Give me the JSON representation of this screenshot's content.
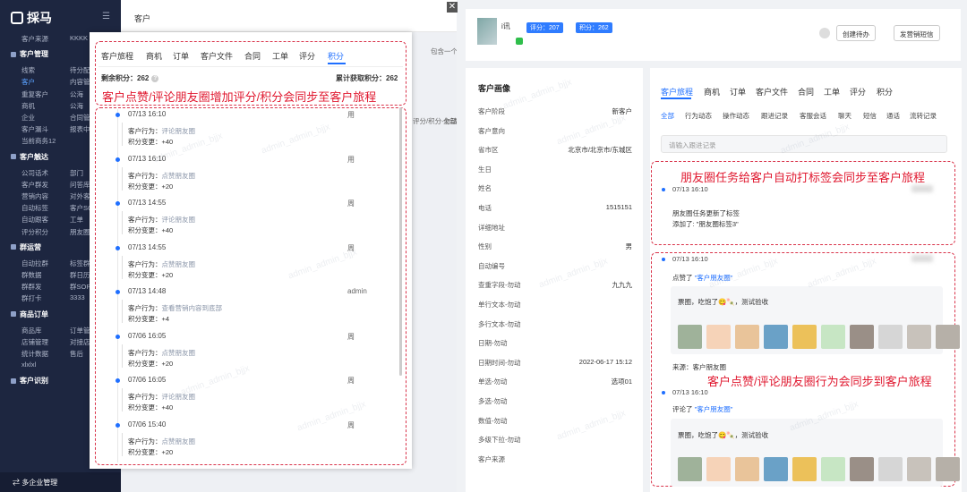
{
  "sidebar": {
    "logo": "採马",
    "items": [
      {
        "kind": "row",
        "a": "客户来源",
        "b": "KKKK"
      },
      {
        "kind": "group",
        "label": "客户管理"
      },
      {
        "kind": "row",
        "a": "线索",
        "b": "待分配"
      },
      {
        "kind": "row",
        "a": "客户",
        "b": "内容管",
        "active": true
      },
      {
        "kind": "row",
        "a": "重复客户",
        "b": "公海"
      },
      {
        "kind": "row",
        "a": "商机",
        "b": "公海"
      },
      {
        "kind": "row",
        "a": "企业",
        "b": "合同管"
      },
      {
        "kind": "row",
        "a": "客户漏斗",
        "b": "报表中"
      },
      {
        "kind": "row",
        "a": "当前商务12",
        "b": ""
      },
      {
        "kind": "group",
        "label": "客户触达"
      },
      {
        "kind": "row",
        "a": "公司话术",
        "b": "部门"
      },
      {
        "kind": "row",
        "a": "客户群发",
        "b": "问答库"
      },
      {
        "kind": "row",
        "a": "营销内容",
        "b": "对外客"
      },
      {
        "kind": "row",
        "a": "自动标签",
        "b": "客户SO"
      },
      {
        "kind": "row",
        "a": "自动跟客",
        "b": "工单"
      },
      {
        "kind": "row",
        "a": "评分积分",
        "b": "朋友圈"
      },
      {
        "kind": "group",
        "label": "群运营"
      },
      {
        "kind": "row",
        "a": "自动拉群",
        "b": "标签群"
      },
      {
        "kind": "row",
        "a": "群数据",
        "b": "群日历"
      },
      {
        "kind": "row",
        "a": "群群发",
        "b": "群SOP"
      },
      {
        "kind": "row",
        "a": "群打卡",
        "b": "3333"
      },
      {
        "kind": "group",
        "label": "商品订单"
      },
      {
        "kind": "row",
        "a": "商品库",
        "b": "订单管"
      },
      {
        "kind": "row",
        "a": "店铺管理",
        "b": "对接店"
      },
      {
        "kind": "row",
        "a": "统计数据",
        "b": "售后"
      },
      {
        "kind": "row",
        "a": "xlxlxl",
        "b": ""
      },
      {
        "kind": "group",
        "label": "客户识别"
      }
    ],
    "bottom": "多企业管理"
  },
  "left_page": {
    "title": "客户",
    "bg_texts": [
      "包含一个",
      "全部",
      "评分/积分-勿动"
    ]
  },
  "popup": {
    "tabs": [
      "客户旅程",
      "商机",
      "订单",
      "客户文件",
      "合同",
      "工单",
      "评分",
      "积分"
    ],
    "active_tab": 7,
    "remaining_label": "剩余积分：262",
    "total_label": "累计获取积分：262",
    "annotation": "客户点赞/评论朋友圈增加评分/积分会同步至客户旅程",
    "action_label": "客户行为：",
    "change_label": "积分变更：",
    "entries": [
      {
        "time": "07/13 16:10",
        "who": "用",
        "action": "评论朋友圈",
        "change": "+40"
      },
      {
        "time": "07/13 16:10",
        "who": "用",
        "action": "点赞朋友圈",
        "change": "+20"
      },
      {
        "time": "07/13 14:55",
        "who": "周",
        "action": "评论朋友圈",
        "change": "+40"
      },
      {
        "time": "07/13 14:55",
        "who": "周",
        "action": "点赞朋友圈",
        "change": "+20"
      },
      {
        "time": "07/13 14:48",
        "who": "admin",
        "action": "查看营销内容到底部",
        "change": "+4"
      },
      {
        "time": "07/06 16:05",
        "who": "周",
        "action": "点赞朋友圈",
        "change": "+20"
      },
      {
        "time": "07/06 16:05",
        "who": "周",
        "action": "评论朋友圈",
        "change": "+40"
      },
      {
        "time": "07/06 15:40",
        "who": "周",
        "action": "点赞朋友圈",
        "change": "+20"
      }
    ]
  },
  "right_panel": {
    "customer_name": "i讯",
    "badge_score": "评分：207",
    "badge_points": "积分：262",
    "btn_task": "创建待办",
    "btn_sms": "发营销短信",
    "profile_title": "客户画像",
    "profile_fields": [
      {
        "label": "客户阶段",
        "value": "新客户"
      },
      {
        "label": "客户意向",
        "value": ""
      },
      {
        "label": "省市区",
        "value": "北京市/北京市/东城区"
      },
      {
        "label": "生日",
        "value": ""
      },
      {
        "label": "姓名",
        "value": ""
      },
      {
        "label": "电话",
        "value": "1515151"
      },
      {
        "label": "详细地址",
        "value": ""
      },
      {
        "label": "性别",
        "value": "男"
      },
      {
        "label": "自动编号",
        "value": ""
      },
      {
        "label": "查重字段-勿动",
        "value": "九九九"
      },
      {
        "label": "单行文本-勿动",
        "value": ""
      },
      {
        "label": "多行文本-勿动",
        "value": ""
      },
      {
        "label": "日期-勿动",
        "value": ""
      },
      {
        "label": "日期时间-勿动",
        "value": "2022-06-17 15:12"
      },
      {
        "label": "单选-勿动",
        "value": "选项01"
      },
      {
        "label": "多选-勿动",
        "value": ""
      },
      {
        "label": "数值-勿动",
        "value": ""
      },
      {
        "label": "多级下拉-勿动",
        "value": ""
      },
      {
        "label": "客户来源",
        "value": ""
      }
    ],
    "journey_tabs": [
      "客户旅程",
      "商机",
      "订单",
      "客户文件",
      "合同",
      "工单",
      "评分",
      "积分"
    ],
    "journey_subtabs": [
      "全部",
      "行为动态",
      "操作动态",
      "跟进记录",
      "客服会话",
      "聊天",
      "短信",
      "通话",
      "流转记录"
    ],
    "search_placeholder": "请输入跟进记录",
    "annot_tag": "朋友圈任务给客户自动打标签会同步至客户旅程",
    "annot_like": "客户点赞/评论朋友圈行为会同步到客户旅程",
    "events": [
      {
        "time": "07/13 16:10",
        "line1": "朋友圈任务更新了标签",
        "line2": "添加了: \"朋友圈标签3\""
      },
      {
        "time": "07/13 16:10",
        "verb": "点赞了",
        "target": "\"客户朋友圈\"",
        "post_text": "票圈，吃饱了😋🍡，测试验收",
        "source": "来源：客户朋友圈"
      },
      {
        "time": "07/13 16:10",
        "verb": "评论了",
        "target": "\"客户朋友圈\"",
        "post_text": "票圈，吃饱了😋🍡，测试验收"
      }
    ]
  },
  "watermark": "admin_admin_bjjx"
}
